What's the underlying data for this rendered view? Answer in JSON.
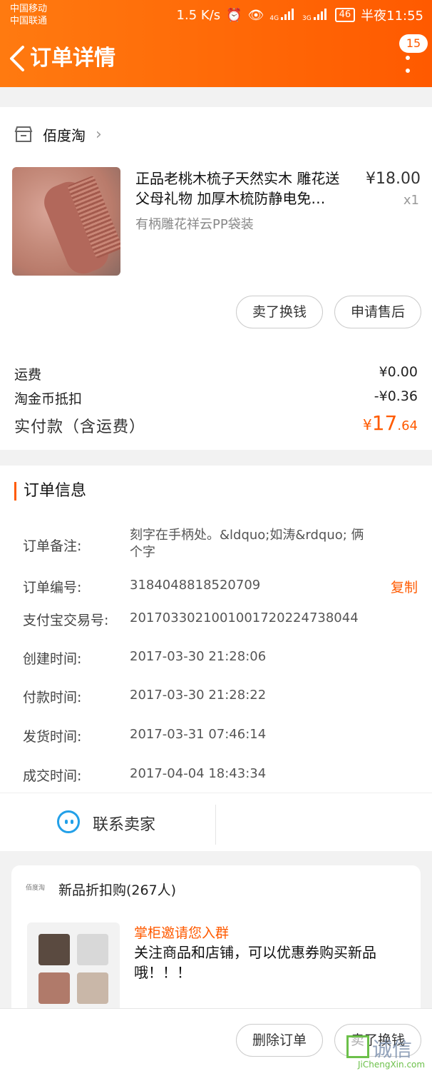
{
  "status": {
    "carrier1": "中国移动",
    "carrier2": "中国联通",
    "speed": "1.5 K/s",
    "sig1": "4G",
    "sig2": "3G",
    "battery": "46",
    "time": "半夜11:55"
  },
  "header": {
    "title": "订单详情",
    "badge": "15"
  },
  "store": {
    "name": "佰度淘"
  },
  "product": {
    "title": "正品老桃木梳子天然实木 雕花送父母礼物 加厚木梳防静电免…",
    "spec": "有柄雕花祥云PP袋装",
    "price": "¥18.00",
    "qty": "x1",
    "btn_sell": "卖了换钱",
    "btn_aftersale": "申请售后"
  },
  "fees": {
    "shipping_label": "运费",
    "shipping_val": "¥0.00",
    "coin_label": "淘金币抵扣",
    "coin_val": "-¥0.36",
    "paid_label": "实付款（含运费）",
    "paid_sym": "¥",
    "paid_int": "17",
    "paid_dec": ".64"
  },
  "order": {
    "section_title": "订单信息",
    "note_label": "订单备注:",
    "note_val": "刻字在手柄处。&ldquo;如涛&rdquo; 俩个字",
    "no_label": "订单编号:",
    "no_val": "3184048818520709",
    "copy": "复制",
    "alipay_label": "支付宝交易号:",
    "alipay_val": "2017033021001001720224738044",
    "created_label": "创建时间:",
    "created_val": "2017-03-30 21:28:06",
    "paid_label": "付款时间:",
    "paid_val": "2017-03-30 21:28:22",
    "shipped_label": "发货时间:",
    "shipped_val": "2017-03-31 07:46:14",
    "done_label": "成交时间:",
    "done_val": "2017-04-04 18:43:34"
  },
  "contact": {
    "label": "联系卖家"
  },
  "promo": {
    "logo": "佰度淘",
    "head": "新品折扣购(267人)",
    "sub": "掌柜邀请您入群",
    "text": "关注商品和店铺，可以优惠券购买新品哦！！！"
  },
  "bottom": {
    "delete": "删除订单",
    "sell": "卖了换钱"
  },
  "watermark": {
    "text": "诚信",
    "url": "JiChengXin.com"
  },
  "colors": {
    "accent": "#ff5a00",
    "header_start": "#ff7a10",
    "contact_icon": "#23a0e8"
  }
}
